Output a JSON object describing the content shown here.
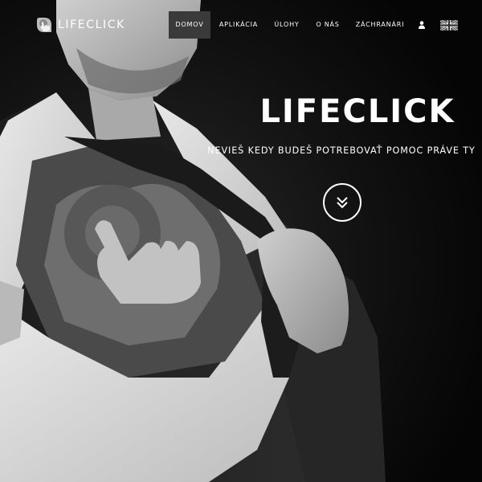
{
  "brand": {
    "name": "LIFECLICK",
    "logo_icon": "hand-pointer-heart-icon"
  },
  "nav": {
    "items": [
      {
        "label": "DOMOV",
        "active": true
      },
      {
        "label": "APLIKÁCIA",
        "active": false
      },
      {
        "label": "ÚLOHY",
        "active": false
      },
      {
        "label": "O NÁS",
        "active": false
      },
      {
        "label": "ZÁCHRANÁRI",
        "active": false
      }
    ],
    "user_icon": "user-icon",
    "language_icon": "uk-flag-icon"
  },
  "hero": {
    "title": "LIFECLICK",
    "subtitle": "NEVIEŠ KEDY BUDEŠ POTREBOVAŤ POMOC PRÁVE TY",
    "scroll_icon": "double-chevron-down-icon"
  },
  "colors": {
    "text": "#ffffff",
    "active_nav_bg": "#3a3a3a",
    "background": "#0b0b0b"
  }
}
